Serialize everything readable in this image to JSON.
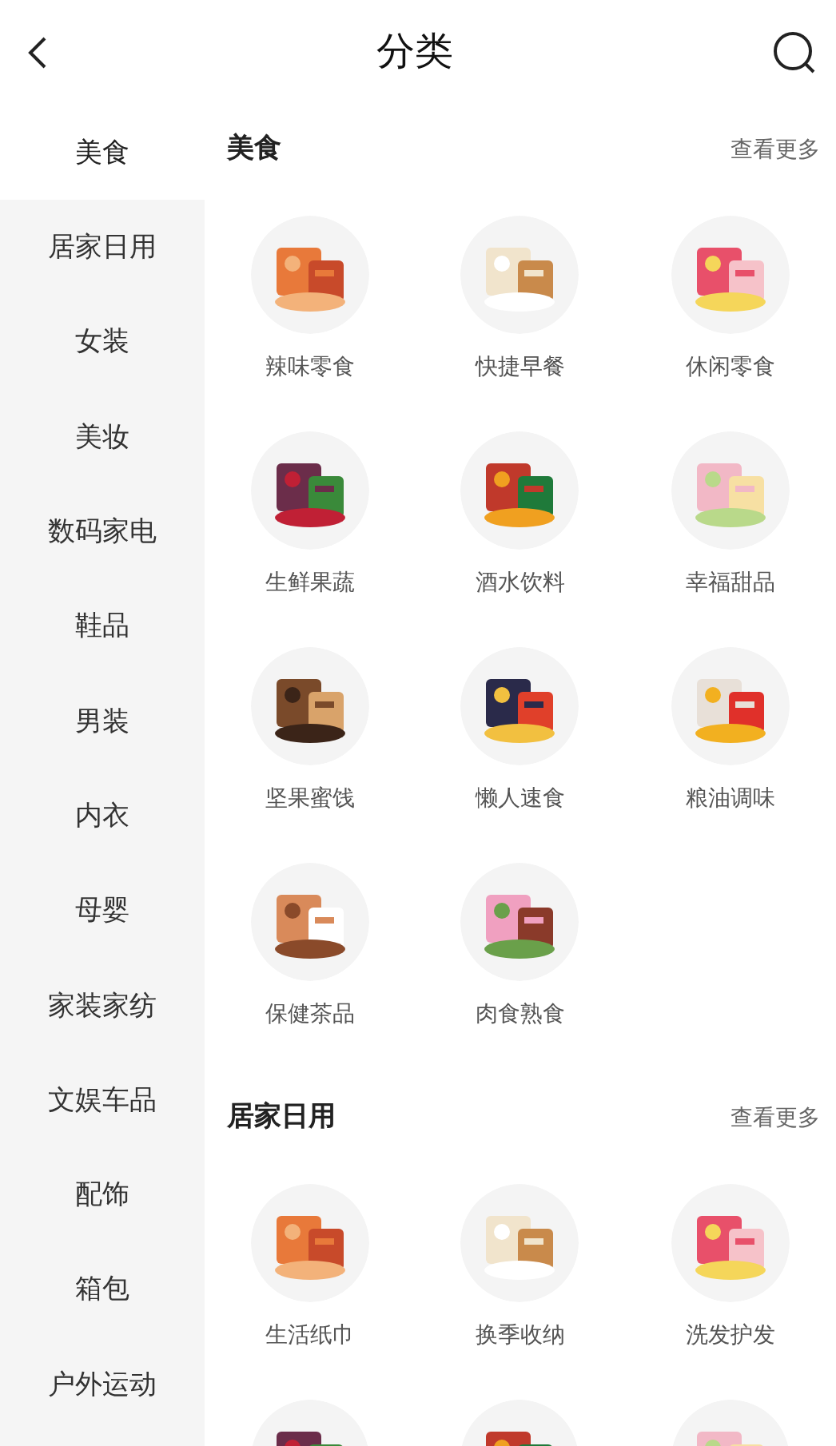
{
  "header": {
    "title": "分类"
  },
  "sidebar": {
    "items": [
      {
        "label": "美食",
        "selected": true
      },
      {
        "label": "居家日用",
        "selected": false
      },
      {
        "label": "女装",
        "selected": false
      },
      {
        "label": "美妆",
        "selected": false
      },
      {
        "label": "数码家电",
        "selected": false
      },
      {
        "label": "鞋品",
        "selected": false
      },
      {
        "label": "男装",
        "selected": false
      },
      {
        "label": "内衣",
        "selected": false
      },
      {
        "label": "母婴",
        "selected": false
      },
      {
        "label": "家装家纺",
        "selected": false
      },
      {
        "label": "文娱车品",
        "selected": false
      },
      {
        "label": "配饰",
        "selected": false
      },
      {
        "label": "箱包",
        "selected": false
      },
      {
        "label": "户外运动",
        "selected": false
      }
    ]
  },
  "sections": [
    {
      "title": "美食",
      "more": "查看更多",
      "items": [
        {
          "kind": "category",
          "label": "辣味零食"
        },
        {
          "kind": "category",
          "label": "快捷早餐"
        },
        {
          "kind": "category",
          "label": "休闲零食"
        },
        {
          "kind": "category",
          "label": "生鲜果蔬"
        },
        {
          "kind": "category",
          "label": "酒水饮料"
        },
        {
          "kind": "category",
          "label": "幸福甜品"
        },
        {
          "kind": "category",
          "label": "坚果蜜饯"
        },
        {
          "kind": "category",
          "label": "懒人速食"
        },
        {
          "kind": "category",
          "label": "粮油调味"
        },
        {
          "kind": "category",
          "label": "保健茶品"
        },
        {
          "kind": "category",
          "label": "肉食熟食"
        }
      ]
    },
    {
      "title": "居家日用",
      "more": "查看更多",
      "items": [
        {
          "kind": "category",
          "label": "生活纸巾"
        },
        {
          "kind": "category",
          "label": "换季收纳"
        },
        {
          "kind": "category",
          "label": "洗发护发"
        },
        {
          "kind": "picture"
        },
        {
          "kind": "picture"
        },
        {
          "kind": "picture"
        }
      ]
    }
  ]
}
